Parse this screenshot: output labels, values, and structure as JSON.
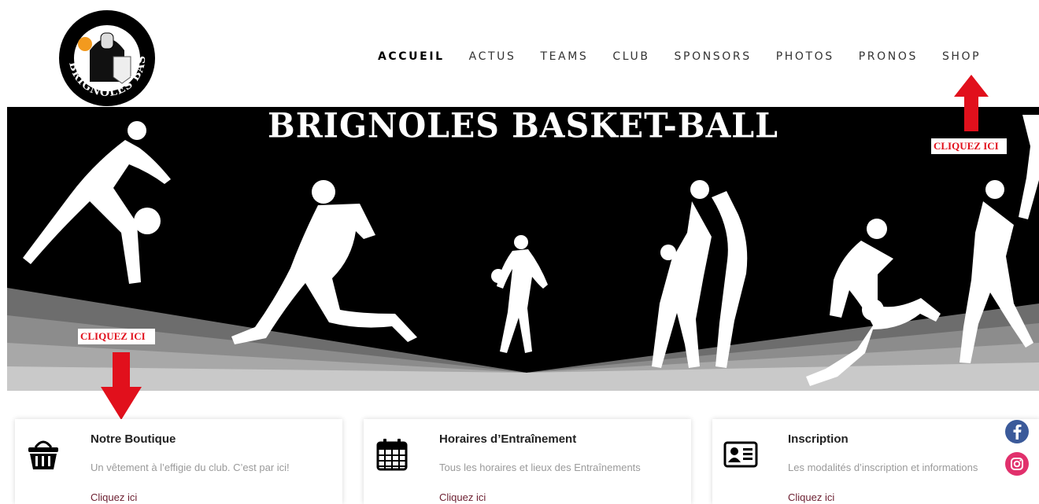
{
  "header": {
    "logo_text": "BRIGNOLES BASKET BALL",
    "nav": [
      "ACCUEIL",
      "ACTUS",
      "TEAMS",
      "CLUB",
      "SPONSORS",
      "PHOTOS",
      "PRONOS",
      "SHOP"
    ],
    "active_nav": "ACCUEIL"
  },
  "hero": {
    "title": "BRIGNOLES BASKET-BALL",
    "annotation_top": "CLIQUEZ ICI",
    "annotation_bottom": "CLIQUEZ ICI",
    "annotation_color": "#e1101c"
  },
  "cards": [
    {
      "icon": "basket-icon",
      "title": "Notre Boutique",
      "desc": "Un vêtement à l’effigie du club. C’est par ici!",
      "link": "Cliquez ici"
    },
    {
      "icon": "calendar-icon",
      "title": "Horaires d’Entraînement",
      "desc": "Tous les horaires et lieux des Entraînements",
      "link": "Cliquez ici"
    },
    {
      "icon": "id-card-icon",
      "title": "Inscription",
      "desc": "Les modalités d’inscription et informations",
      "link": "Cliquez ici"
    }
  ],
  "social": [
    "facebook-icon",
    "instagram-icon"
  ],
  "colors": {
    "link": "#6b1d2f",
    "arrow": "#e1101c"
  }
}
